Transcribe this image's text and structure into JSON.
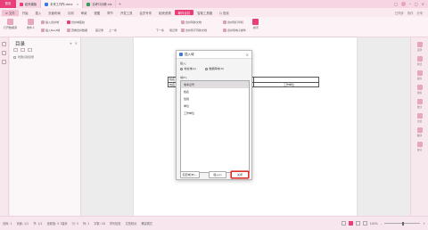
{
  "titlebar": {
    "home": "首页",
    "tabs": [
      {
        "label": "稻壳模板",
        "icon_color": "#e83f7a"
      },
      {
        "label": "未来工作所.docx",
        "icon_color": "#3b7be0"
      },
      {
        "label": "请考口训练.xls",
        "icon_color": "#2f9e5e"
      }
    ],
    "add": "+",
    "right_icons": [
      "□",
      "⌂"
    ]
  },
  "menubar": {
    "file": "≡ 文件",
    "items": [
      "开始",
      "插入",
      "页面布局",
      "引用",
      "审阅",
      "视图",
      "章节",
      "开发工具",
      "会员专享",
      "稻壳资源",
      "邮件合并",
      "智能工具箱",
      "工具"
    ],
    "highlight": "邮件合并",
    "search": "Q 查找",
    "right": [
      "已同步",
      "协作",
      "分享"
    ]
  },
  "ribbon": {
    "big": [
      {
        "label": "打开数据源"
      },
      {
        "label": "收件人"
      }
    ],
    "small": [
      {
        "label": "插入合并域"
      },
      {
        "label": "插入Next域"
      },
      {
        "label": "合并域底纹"
      },
      {
        "label": "查看合并数据"
      },
      {
        "label": "首记录"
      },
      {
        "label": "上一条"
      },
      {
        "label": "下一条"
      },
      {
        "label": "尾记录"
      },
      {
        "label": "合并到新文档"
      },
      {
        "label": "合并到不同新文档"
      },
      {
        "label": "合并到打印机"
      },
      {
        "label": "合并到电子邮件"
      },
      {
        "label": "关闭"
      }
    ]
  },
  "navpanel": {
    "title": "目录",
    "item": "智能识别目录"
  },
  "document": {
    "cell_left": "姓名",
    "cell_right": "工作单位",
    "cell_row2": "姓名"
  },
  "dialog": {
    "title": "插入域",
    "insert_label": "插入：",
    "radio_address": "地址域(A)",
    "radio_database": "数据库域(D)",
    "fields_label": "域(F)：",
    "fields": [
      "准考证号",
      "姓名",
      "性别",
      "单位",
      "工作单位"
    ],
    "selected_field": "准考证号",
    "btn_match": "匹配域(M)...",
    "btn_insert": "插入(I)",
    "btn_close": "关闭"
  },
  "rightrail": {
    "items": [
      "选择",
      "样式",
      "属性",
      "排版",
      "批注",
      "文档",
      "翻译",
      "校对"
    ]
  },
  "status": {
    "page": "页码: 1",
    "pages": "页面: 1/1",
    "section": "节: 1/1",
    "setting": "设置值: 5.7厘米",
    "row": "行: 3",
    "col": "列: 1",
    "words": "字数: 18",
    "spell": "拼写检查",
    "proof": "文档校对",
    "compat": "兼容模式",
    "zoom": "100%"
  },
  "colors": {
    "accent": "#e83f7a",
    "highlight_border": "#e0302c"
  }
}
